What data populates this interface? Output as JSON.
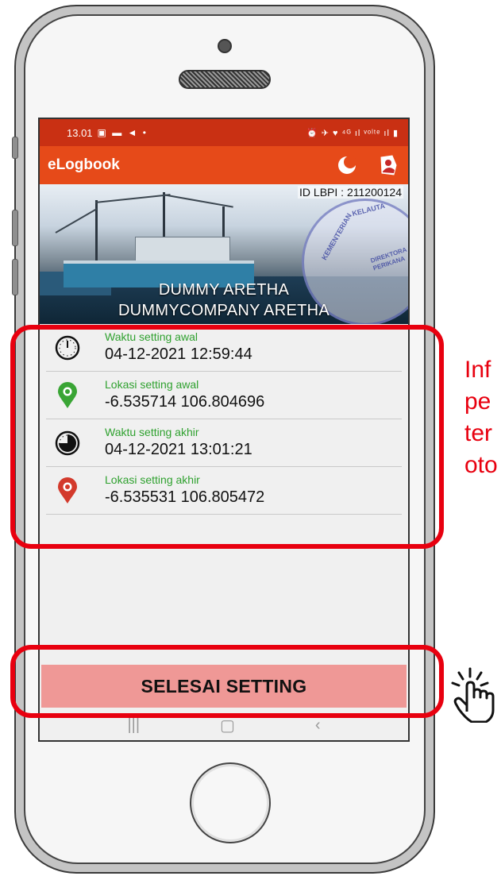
{
  "status_bar": {
    "time": "13.01",
    "left_icons": "▣ ▬ ◄ •",
    "right_icons": "⏰ ✈ ♥ ⁴ᴳ ıl ᵛᵒˡᵗᵉ ıl ▮"
  },
  "app_bar": {
    "title": "eLogbook",
    "actions": [
      {
        "name": "night-mode-icon"
      },
      {
        "name": "profile-icon"
      }
    ]
  },
  "banner": {
    "id_label": "ID LBPI : 211200124",
    "vessel_name": "DUMMY ARETHA",
    "company_name": "DUMMYCOMPANY ARETHA",
    "stamp_text_top": "KELAUTA",
    "stamp_text_left": "KEMENTERIAN",
    "stamp_text_right": "DIREKTORA PERIKANA"
  },
  "info_items": [
    {
      "icon": "clock-start-icon",
      "label": "Waktu setting awal",
      "value": "04-12-2021 12:59:44"
    },
    {
      "icon": "location-start-icon",
      "label": "Lokasi setting awal",
      "value": "-6.535714 106.804696",
      "color": "#3aa535"
    },
    {
      "icon": "clock-end-icon",
      "label": "Waktu setting akhir",
      "value": "04-12-2021 13:01:21"
    },
    {
      "icon": "location-end-icon",
      "label": "Lokasi setting akhir",
      "value": "-6.535531 106.805472",
      "color": "#d33a2c"
    }
  ],
  "finish_button": {
    "label": "SELESAI SETTING"
  },
  "nav_bar": {
    "recent": "|||",
    "home": "▢",
    "back": "‹"
  },
  "annotation": {
    "text": "Inf\npe\nter\noto",
    "color": "#e8000f"
  },
  "colors": {
    "status_bar": "#c93013",
    "app_bar": "#e64a19",
    "button": "#ef9896",
    "label_green": "#2fa12f"
  }
}
